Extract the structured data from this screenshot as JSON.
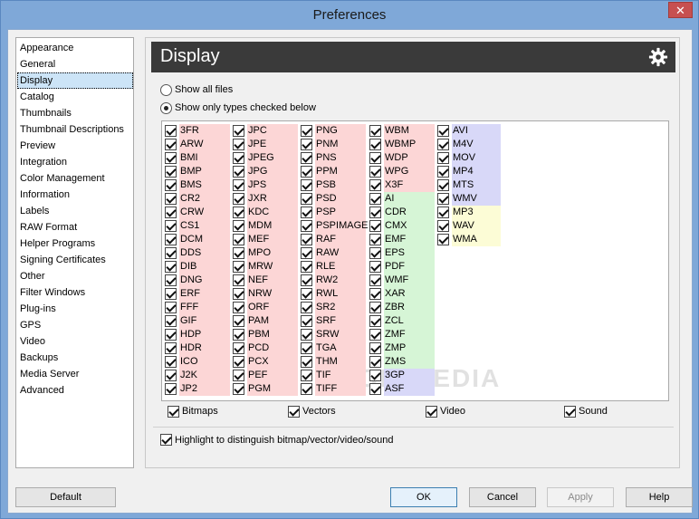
{
  "window": {
    "title": "Preferences",
    "close_glyph": "✕"
  },
  "sidebar": {
    "items": [
      "Appearance",
      "General",
      "Display",
      "Catalog",
      "Thumbnails",
      "Thumbnail Descriptions",
      "Preview",
      "Integration",
      "Color Management",
      "Information",
      "Labels",
      "RAW Format",
      "Helper Programs",
      "Signing Certificates",
      "Other",
      "Filter Windows",
      "Plug-ins",
      "GPS",
      "Video",
      "Backups",
      "Media Server",
      "Advanced"
    ],
    "selected": "Display"
  },
  "panel": {
    "title": "Display",
    "gear_icon": "gear-icon",
    "radio_all": "Show all files",
    "radio_types": "Show only types checked below",
    "radio_selected": "types"
  },
  "columns": [
    [
      {
        "label": "3FR",
        "cat": "bitmap"
      },
      {
        "label": "ARW",
        "cat": "bitmap"
      },
      {
        "label": "BMI",
        "cat": "bitmap"
      },
      {
        "label": "BMP",
        "cat": "bitmap"
      },
      {
        "label": "BMS",
        "cat": "bitmap"
      },
      {
        "label": "CR2",
        "cat": "bitmap"
      },
      {
        "label": "CRW",
        "cat": "bitmap"
      },
      {
        "label": "CS1",
        "cat": "bitmap"
      },
      {
        "label": "DCM",
        "cat": "bitmap"
      },
      {
        "label": "DDS",
        "cat": "bitmap"
      },
      {
        "label": "DIB",
        "cat": "bitmap"
      },
      {
        "label": "DNG",
        "cat": "bitmap"
      },
      {
        "label": "ERF",
        "cat": "bitmap"
      },
      {
        "label": "FFF",
        "cat": "bitmap"
      },
      {
        "label": "GIF",
        "cat": "bitmap"
      },
      {
        "label": "HDP",
        "cat": "bitmap"
      },
      {
        "label": "HDR",
        "cat": "bitmap"
      },
      {
        "label": "ICO",
        "cat": "bitmap"
      },
      {
        "label": "J2K",
        "cat": "bitmap"
      },
      {
        "label": "JP2",
        "cat": "bitmap"
      }
    ],
    [
      {
        "label": "JPC",
        "cat": "bitmap"
      },
      {
        "label": "JPE",
        "cat": "bitmap"
      },
      {
        "label": "JPEG",
        "cat": "bitmap"
      },
      {
        "label": "JPG",
        "cat": "bitmap"
      },
      {
        "label": "JPS",
        "cat": "bitmap"
      },
      {
        "label": "JXR",
        "cat": "bitmap"
      },
      {
        "label": "KDC",
        "cat": "bitmap"
      },
      {
        "label": "MDM",
        "cat": "bitmap"
      },
      {
        "label": "MEF",
        "cat": "bitmap"
      },
      {
        "label": "MPO",
        "cat": "bitmap"
      },
      {
        "label": "MRW",
        "cat": "bitmap"
      },
      {
        "label": "NEF",
        "cat": "bitmap"
      },
      {
        "label": "NRW",
        "cat": "bitmap"
      },
      {
        "label": "ORF",
        "cat": "bitmap"
      },
      {
        "label": "PAM",
        "cat": "bitmap"
      },
      {
        "label": "PBM",
        "cat": "bitmap"
      },
      {
        "label": "PCD",
        "cat": "bitmap"
      },
      {
        "label": "PCX",
        "cat": "bitmap"
      },
      {
        "label": "PEF",
        "cat": "bitmap"
      },
      {
        "label": "PGM",
        "cat": "bitmap"
      }
    ],
    [
      {
        "label": "PNG",
        "cat": "bitmap"
      },
      {
        "label": "PNM",
        "cat": "bitmap"
      },
      {
        "label": "PNS",
        "cat": "bitmap"
      },
      {
        "label": "PPM",
        "cat": "bitmap"
      },
      {
        "label": "PSB",
        "cat": "bitmap"
      },
      {
        "label": "PSD",
        "cat": "bitmap"
      },
      {
        "label": "PSP",
        "cat": "bitmap"
      },
      {
        "label": "PSPIMAGE",
        "cat": "bitmap"
      },
      {
        "label": "RAF",
        "cat": "bitmap"
      },
      {
        "label": "RAW",
        "cat": "bitmap"
      },
      {
        "label": "RLE",
        "cat": "bitmap"
      },
      {
        "label": "RW2",
        "cat": "bitmap"
      },
      {
        "label": "RWL",
        "cat": "bitmap"
      },
      {
        "label": "SR2",
        "cat": "bitmap"
      },
      {
        "label": "SRF",
        "cat": "bitmap"
      },
      {
        "label": "SRW",
        "cat": "bitmap"
      },
      {
        "label": "TGA",
        "cat": "bitmap"
      },
      {
        "label": "THM",
        "cat": "bitmap"
      },
      {
        "label": "TIF",
        "cat": "bitmap"
      },
      {
        "label": "TIFF",
        "cat": "bitmap"
      }
    ],
    [
      {
        "label": "WBM",
        "cat": "bitmap"
      },
      {
        "label": "WBMP",
        "cat": "bitmap"
      },
      {
        "label": "WDP",
        "cat": "bitmap"
      },
      {
        "label": "WPG",
        "cat": "bitmap"
      },
      {
        "label": "X3F",
        "cat": "bitmap"
      },
      {
        "label": "AI",
        "cat": "vector"
      },
      {
        "label": "CDR",
        "cat": "vector"
      },
      {
        "label": "CMX",
        "cat": "vector"
      },
      {
        "label": "EMF",
        "cat": "vector"
      },
      {
        "label": "EPS",
        "cat": "vector"
      },
      {
        "label": "PDF",
        "cat": "vector"
      },
      {
        "label": "WMF",
        "cat": "vector"
      },
      {
        "label": "XAR",
        "cat": "vector"
      },
      {
        "label": "ZBR",
        "cat": "vector"
      },
      {
        "label": "ZCL",
        "cat": "vector"
      },
      {
        "label": "ZMF",
        "cat": "vector"
      },
      {
        "label": "ZMP",
        "cat": "vector"
      },
      {
        "label": "ZMS",
        "cat": "vector"
      },
      {
        "label": "3GP",
        "cat": "video"
      },
      {
        "label": "ASF",
        "cat": "video"
      }
    ],
    [
      {
        "label": "AVI",
        "cat": "video"
      },
      {
        "label": "M4V",
        "cat": "video"
      },
      {
        "label": "MOV",
        "cat": "video"
      },
      {
        "label": "MP4",
        "cat": "video"
      },
      {
        "label": "MTS",
        "cat": "video"
      },
      {
        "label": "WMV",
        "cat": "video"
      },
      {
        "label": "MP3",
        "cat": "sound"
      },
      {
        "label": "WAV",
        "cat": "sound"
      },
      {
        "label": "WMA",
        "cat": "sound"
      }
    ]
  ],
  "categories": {
    "bitmaps": "Bitmaps",
    "vectors": "Vectors",
    "video": "Video",
    "sound": "Sound"
  },
  "highlight_label": "Highlight to distinguish bitmap/vector/video/sound",
  "colors": {
    "bitmap": "#fcd6d6",
    "vector": "#d6f5d6",
    "video": "#d8d8f8",
    "sound": "#fcfcd6",
    "header_bg": "#3a3a3a",
    "title_bar": "#7fa8d8"
  },
  "watermark": "SOFTPEDIA",
  "buttons": {
    "default": "Default",
    "ok": "OK",
    "cancel": "Cancel",
    "apply": "Apply",
    "help": "Help"
  }
}
